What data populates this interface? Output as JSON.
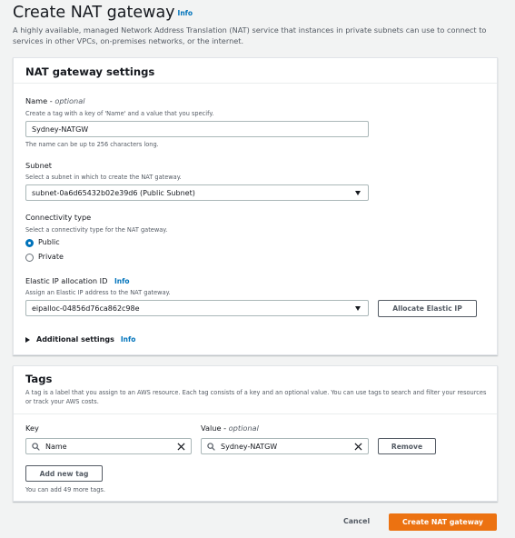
{
  "page": {
    "title": "Create NAT gateway",
    "info": "Info",
    "description": "A highly available, managed Network Address Translation (NAT) service that instances in private subnets can use to connect to services in other VPCs, on-premises networks, or the internet."
  },
  "settings": {
    "title": "NAT gateway settings",
    "name": {
      "label": "Name - ",
      "optional": "optional",
      "hint": "Create a tag with a key of 'Name' and a value that you specify.",
      "value": "Sydney-NATGW",
      "constraint": "The name can be up to 256 characters long."
    },
    "subnet": {
      "label": "Subnet",
      "hint": "Select a subnet in which to create the NAT gateway.",
      "value": "subnet-0a6d65432b02e39d6 (Public Subnet)"
    },
    "connectivity": {
      "label": "Connectivity type",
      "hint": "Select a connectivity type for the NAT gateway.",
      "options": [
        "Public",
        "Private"
      ],
      "selected": "Public"
    },
    "elastic_ip": {
      "label": "Elastic IP allocation ID",
      "info": "Info",
      "hint": "Assign an Elastic IP address to the NAT gateway.",
      "value": "eipalloc-04856d76ca862c98e",
      "allocate_button": "Allocate Elastic IP"
    },
    "additional": {
      "label": "Additional settings",
      "info": "Info"
    }
  },
  "tags": {
    "title": "Tags",
    "description": "A tag is a label that you assign to an AWS resource. Each tag consists of a key and an optional value. You can use tags to search and filter your resources or track your AWS costs.",
    "key_label": "Key",
    "value_label": "Value - ",
    "value_optional": "optional",
    "key_value": "Name",
    "value_value": "Sydney-NATGW",
    "remove_button": "Remove",
    "add_button": "Add new tag",
    "remaining": "You can add 49 more tags."
  },
  "footer": {
    "cancel": "Cancel",
    "create": "Create NAT gateway"
  },
  "colors": {
    "primary": "#ec7211",
    "link": "#0073bb",
    "radio_selected": "#0073bb"
  }
}
